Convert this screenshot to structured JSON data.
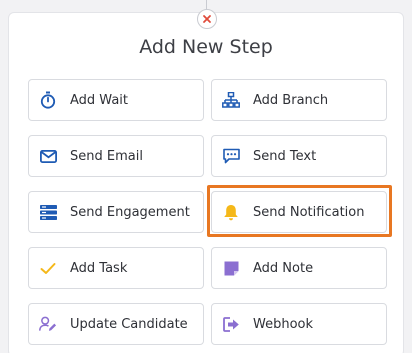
{
  "dialog": {
    "title": "Add New Step",
    "close_icon": "close-icon"
  },
  "colors": {
    "blue": "#1f5bb4",
    "purple": "#8b6fd1",
    "yellow": "#f5b819",
    "close_red": "#e04b3b",
    "highlight": "#e87722"
  },
  "steps": [
    {
      "label": "Add Wait",
      "icon": "stopwatch-icon"
    },
    {
      "label": "Add Branch",
      "icon": "branch-icon"
    },
    {
      "label": "Send Email",
      "icon": "email-icon"
    },
    {
      "label": "Send Text",
      "icon": "chat-icon"
    },
    {
      "label": "Send Engagement",
      "icon": "engagement-icon"
    },
    {
      "label": "Send Notification",
      "icon": "bell-icon"
    },
    {
      "label": "Add Task",
      "icon": "check-icon"
    },
    {
      "label": "Add Note",
      "icon": "note-icon"
    },
    {
      "label": "Update Candidate",
      "icon": "user-edit-icon"
    },
    {
      "label": "Webhook",
      "icon": "webhook-icon"
    }
  ]
}
